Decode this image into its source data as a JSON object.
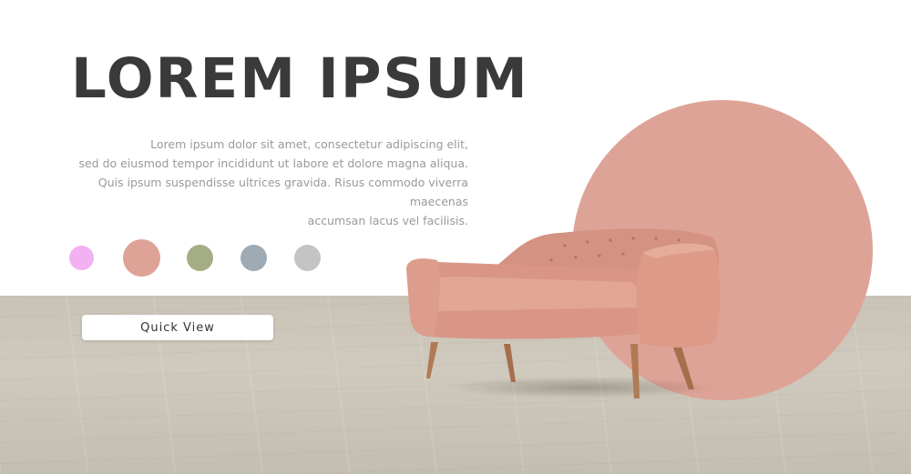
{
  "hero": {
    "title": "LOREM IPSUM",
    "description_lines": [
      "Lorem ipsum dolor sit amet, consectetur adipiscing elit,",
      "sed do eiusmod tempor incididunt ut labore et dolore magna aliqua.",
      "Quis ipsum suspendisse ultrices gravida. Risus commodo viverra maecenas",
      "accumsan lacus vel facilisis."
    ],
    "button_label": "Quick View"
  },
  "swatches": [
    {
      "name": "pink",
      "color": "#f2b2f2",
      "selected": false
    },
    {
      "name": "salmon",
      "color": "#dea397",
      "selected": true
    },
    {
      "name": "olive",
      "color": "#a4ad85",
      "selected": false
    },
    {
      "name": "blue-grey",
      "color": "#9eabb5",
      "selected": false
    },
    {
      "name": "grey",
      "color": "#c4c4c4",
      "selected": false
    }
  ],
  "colors": {
    "accent_circle": "#dea397",
    "sofa": "#dc9786",
    "floor": "#c9c3b6"
  },
  "product": {
    "icon": "sofa-illustration"
  }
}
